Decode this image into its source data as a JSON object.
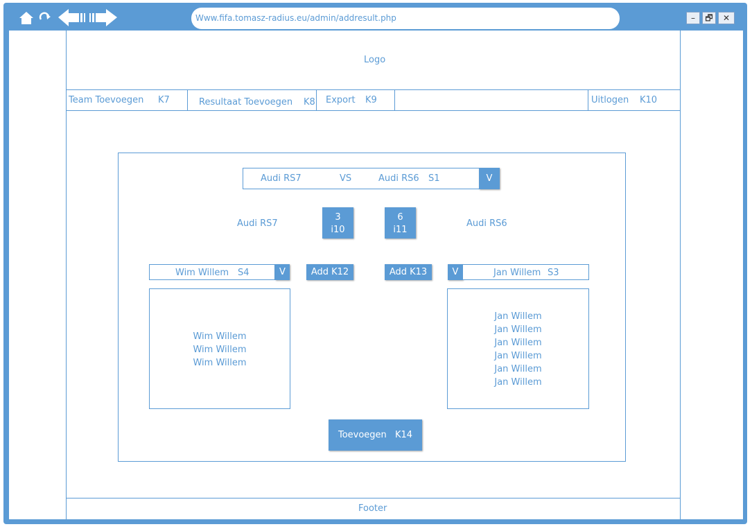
{
  "browser": {
    "url": "Www.fifa.tomasz-radius.eu/admin/addresult.php",
    "buttons": {
      "minimize": "–",
      "restore": "🗗",
      "close": "✕"
    }
  },
  "header": {
    "logo": "Logo"
  },
  "nav": {
    "items": [
      {
        "label": "Team Toevoegen",
        "code": "K7"
      },
      {
        "label": "Resultaat Toevoegen",
        "code": "K8"
      },
      {
        "label": "Export",
        "code": "K9"
      },
      {
        "label": "Uitlogen",
        "code": "K10"
      }
    ]
  },
  "match": {
    "select_home": "Audi RS7",
    "select_vs": "VS",
    "select_away": "Audi RS6",
    "select_code": "S1",
    "dropdown_label": "V",
    "home_team": "Audi RS7",
    "away_team": "Audi RS6",
    "home_score": "3",
    "home_score_code": "i10",
    "away_score": "6",
    "away_score_code": "i11"
  },
  "players": {
    "home_select": "Wim Willem",
    "home_select_code": "S4",
    "away_select": "Jan Willem",
    "away_select_code": "S3",
    "dropdown_label": "V",
    "add_home": "Add K12",
    "add_away": "Add K13",
    "home_list": [
      "Wim Willem",
      "Wim Willem",
      "Wim Willem"
    ],
    "away_list": [
      "Jan Willem",
      "Jan Willem",
      "Jan Willem",
      "Jan Willem",
      "Jan Willem",
      "Jan Willem"
    ]
  },
  "submit": {
    "label": "Toevoegen",
    "code": "K14"
  },
  "footer": {
    "text": "Footer"
  },
  "colors": {
    "accent": "#5b9bd5",
    "background": "#ffffff"
  }
}
